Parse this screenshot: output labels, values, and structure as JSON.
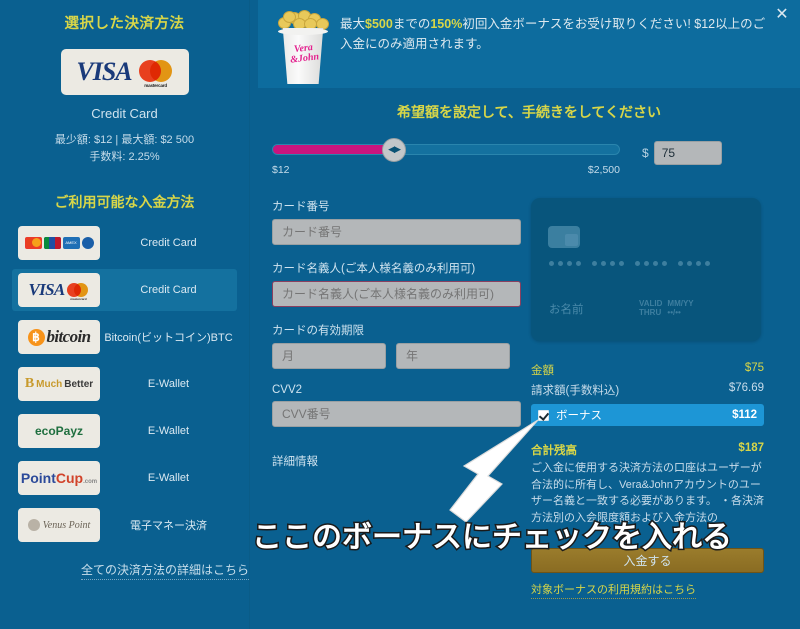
{
  "sidebar": {
    "title": "選択した決済方法",
    "selected": {
      "logo": "visa-mastercard-logo",
      "name": "Credit Card",
      "limits": "最少額: $12 | 最大額: $2 500",
      "fee": "手数料: 2.25%"
    },
    "subtitle": "ご利用可能な入金方法",
    "methods": [
      {
        "logo": "mastercard-jcb-amex-diners-logo",
        "label": "Credit Card",
        "active": false
      },
      {
        "logo": "visa-mastercard-logo",
        "label": "Credit Card",
        "active": true
      },
      {
        "logo": "bitcoin-logo",
        "label": "Bitcoin(ビットコイン)BTC",
        "active": false
      },
      {
        "logo": "muchbetter-logo",
        "label": "E-Wallet",
        "active": false
      },
      {
        "logo": "ecopayz-logo",
        "label": "E-Wallet",
        "active": false
      },
      {
        "logo": "pointcup-logo",
        "label": "E-Wallet",
        "active": false
      },
      {
        "logo": "venuspoint-logo",
        "label": "電子マネー決済",
        "active": false
      }
    ],
    "footer_link": "全ての決済方法の詳細はこちら"
  },
  "banner": {
    "icon": "vera-john-popcorn-bucket-icon",
    "brand": "Vera &John",
    "text_part1": "最大",
    "highlight1": "$500",
    "text_part2": "までの",
    "highlight2": "150%",
    "text_part3": "初回入金ボーナスをお受け取りください! $12以上のご入金にのみ適用されます。",
    "close_icon": "close-icon"
  },
  "amount": {
    "heading": "希望額を設定して、手続きをしてください",
    "slider_min_label": "$12",
    "slider_max_label": "$2,500",
    "slider_min": 12,
    "slider_max": 2500,
    "slider_value": 75,
    "slider_percent": 35,
    "currency": "$",
    "value": "75"
  },
  "form": {
    "card_number": {
      "label": "カード番号",
      "placeholder": "カード番号",
      "value": ""
    },
    "card_holder": {
      "label": "カード名義人(ご本人様名義のみ利用可)",
      "placeholder": "カード名義人(ご本人様名義のみ利用可)",
      "value": ""
    },
    "expiry": {
      "label": "カードの有効期限",
      "month_placeholder": "月",
      "year_placeholder": "年",
      "month_value": "",
      "year_value": ""
    },
    "cvv": {
      "label": "CVV2",
      "placeholder": "CVV番号",
      "value": ""
    },
    "details_link": "詳細情報"
  },
  "card_preview": {
    "chip": "card-chip-icon",
    "number_mask": "•••• •••• •••• ••••",
    "name_placeholder": "お名前",
    "valid_thru_line1": "VALID",
    "valid_thru_line2": "THRU",
    "valid_value_line1": "MM/YY",
    "valid_value_line2": "••/••"
  },
  "summary": {
    "rows": [
      {
        "label": "金額",
        "value": "$75",
        "style": "accent"
      },
      {
        "label": "請求額(手数料込)",
        "value": "$76.69",
        "style": "muted"
      }
    ],
    "bonus": {
      "label": "ボーナス",
      "value": "$112",
      "checked": true
    },
    "total": {
      "label": "合計残高",
      "value": "$187"
    },
    "disclaimer": "ご入金に使用する決済方法の口座はユーザーが合法的に所有し、Vera&Johnアカウントのユーザー名義と一致する必要があります。\n・各決済方法別の入会限度額および入金方法の",
    "deposit_button": "入金する",
    "terms_link": "対象ボーナスの利用規約はこちら"
  },
  "annotation": {
    "arrow": "annotation-arrow-icon",
    "text": "ここのボーナスにチェックを入れる"
  },
  "colors": {
    "background": "#0a6090",
    "banner": "#0d6c9e",
    "accent_yellow": "#d8d648",
    "bonus_row": "#1d96d6",
    "slider_fill": "#c9157e",
    "deposit_button": "#8a6c22",
    "active_row": "#14719f"
  }
}
